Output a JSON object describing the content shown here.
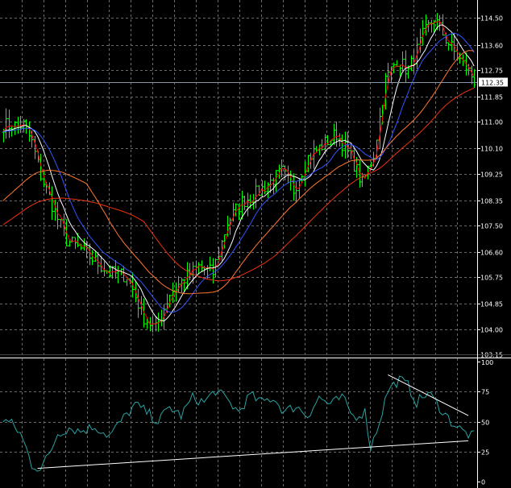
{
  "chart_data": [
    {
      "type": "candlestick",
      "panel": "price",
      "ylim": [
        103.15,
        115.0
      ],
      "y_ticks": [
        "114.50",
        "113.60",
        "112.75",
        "111.85",
        "111.00",
        "110.10",
        "109.25",
        "108.35",
        "107.50",
        "106.60",
        "105.75",
        "104.85",
        "104.00",
        "103.15"
      ],
      "current_price_label": "112.35",
      "current_price": 112.35,
      "grid": true,
      "bar_color": "#00ff00",
      "close_anchors": [
        [
          0,
          110.9
        ],
        [
          5,
          110.85
        ],
        [
          7,
          110.9
        ],
        [
          10,
          110.3
        ],
        [
          13,
          109.2
        ],
        [
          17,
          108.2
        ],
        [
          22,
          107.0
        ],
        [
          27,
          106.7
        ],
        [
          32,
          106.3
        ],
        [
          37,
          105.9
        ],
        [
          43,
          105.8
        ],
        [
          49,
          104.4
        ],
        [
          53,
          104.0
        ],
        [
          58,
          105.2
        ],
        [
          63,
          105.7
        ],
        [
          68,
          106.1
        ],
        [
          73,
          105.9
        ],
        [
          78,
          107.6
        ],
        [
          83,
          108.3
        ],
        [
          87,
          108.5
        ],
        [
          92,
          108.9
        ],
        [
          97,
          109.3
        ],
        [
          101,
          108.7
        ],
        [
          106,
          109.8
        ],
        [
          111,
          110.2
        ],
        [
          116,
          110.6
        ],
        [
          121,
          109.8
        ],
        [
          125,
          108.9
        ],
        [
          129,
          109.9
        ],
        [
          133,
          112.4
        ],
        [
          137,
          113.1
        ],
        [
          141,
          112.7
        ],
        [
          146,
          113.9
        ],
        [
          150,
          114.5
        ],
        [
          154,
          113.8
        ],
        [
          158,
          113.2
        ],
        [
          162,
          112.7
        ],
        [
          164,
          112.4
        ]
      ],
      "moving_averages": [
        {
          "color": "#ff0000",
          "period": "fast"
        },
        {
          "color": "#ffffff",
          "period": "medium"
        },
        {
          "color": "#3355ff",
          "period": "medium-long"
        },
        {
          "color": "#ff7733",
          "period": "long"
        },
        {
          "color": "#ee3311",
          "period": "longest"
        }
      ]
    },
    {
      "type": "line",
      "panel": "oscillator",
      "ylim": [
        0,
        100
      ],
      "y_ticks": [
        "100",
        "75",
        "50",
        "25",
        "0"
      ],
      "line_color": "#29a3a3",
      "anchors": [
        [
          0,
          52
        ],
        [
          3,
          48
        ],
        [
          6,
          40
        ],
        [
          8,
          28
        ],
        [
          10,
          14
        ],
        [
          13,
          11
        ],
        [
          16,
          22
        ],
        [
          19,
          40
        ],
        [
          23,
          45
        ],
        [
          27,
          42
        ],
        [
          32,
          46
        ],
        [
          37,
          38
        ],
        [
          41,
          50
        ],
        [
          46,
          64
        ],
        [
          50,
          58
        ],
        [
          54,
          50
        ],
        [
          58,
          62
        ],
        [
          62,
          55
        ],
        [
          66,
          70
        ],
        [
          70,
          66
        ],
        [
          74,
          76
        ],
        [
          78,
          68
        ],
        [
          82,
          58
        ],
        [
          86,
          72
        ],
        [
          90,
          66
        ],
        [
          94,
          70
        ],
        [
          98,
          58
        ],
        [
          102,
          63
        ],
        [
          106,
          55
        ],
        [
          110,
          70
        ],
        [
          114,
          64
        ],
        [
          118,
          70
        ],
        [
          122,
          54
        ],
        [
          126,
          58
        ],
        [
          128,
          28
        ],
        [
          131,
          50
        ],
        [
          134,
          76
        ],
        [
          138,
          85
        ],
        [
          141,
          80
        ],
        [
          144,
          66
        ],
        [
          148,
          74
        ],
        [
          152,
          62
        ],
        [
          156,
          50
        ],
        [
          160,
          42
        ],
        [
          163,
          38
        ]
      ],
      "trendlines": [
        {
          "from": [
            12,
            11
          ],
          "to": [
            162,
            34
          ]
        },
        {
          "from": [
            134,
            89
          ],
          "to": [
            162,
            55
          ]
        }
      ]
    }
  ]
}
